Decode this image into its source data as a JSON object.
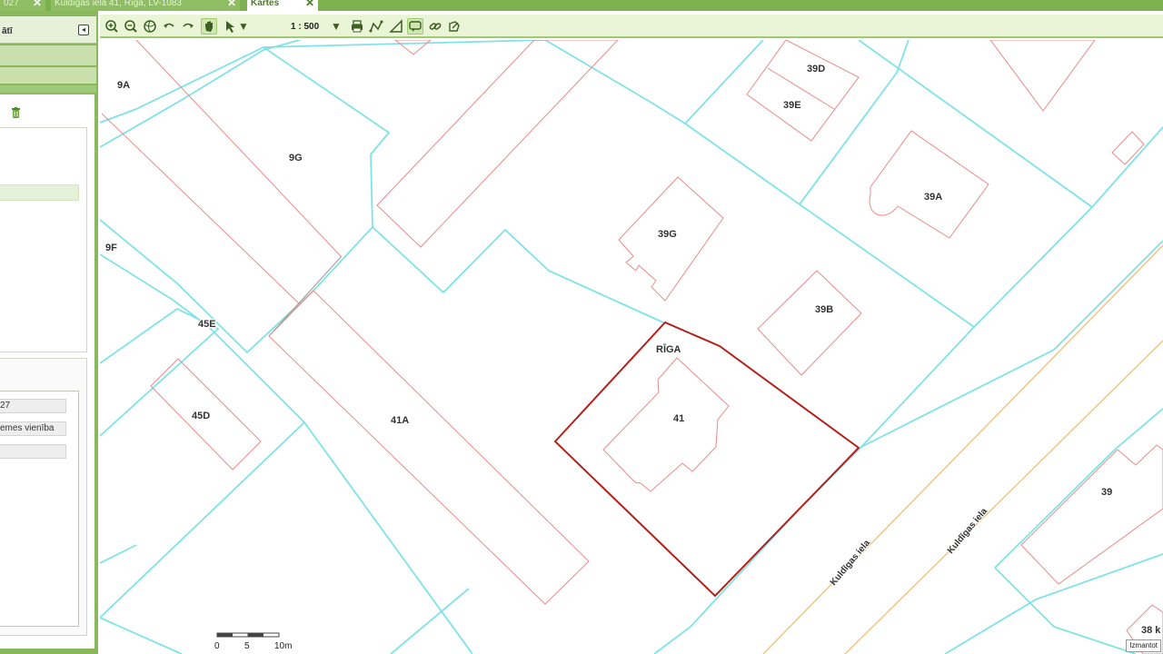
{
  "tabs": [
    {
      "label": "027"
    },
    {
      "label": "Kuldīgas iela 41, Rīga, LV-1083"
    },
    {
      "label": "Kartes"
    }
  ],
  "left_panel": {
    "title": "ātī",
    "fields": [
      "27",
      "emes vienība",
      ""
    ]
  },
  "toolbar": {
    "scale": "1 : 500",
    "tools": [
      "zoom-in",
      "zoom-out",
      "full-extent",
      "undo",
      "redo",
      "pan",
      "select",
      "print",
      "measure-distance",
      "measure-area",
      "callout",
      "link",
      "export"
    ]
  },
  "map": {
    "parcel_labels": [
      "9A",
      "9G",
      "9F",
      "45E",
      "45D",
      "41A",
      "39G",
      "39D",
      "39E",
      "39A",
      "39B",
      "41",
      "39",
      "38 k"
    ],
    "city_label": "RĪGA",
    "street_labels": [
      "Kuldīgas iela",
      "Kuldīgas iela"
    ],
    "scale_bar": {
      "ticks": [
        "0",
        "5",
        "10m"
      ]
    },
    "usage_tag": "Izmantot"
  },
  "colors": {
    "parcel_boundary": "#7fe3e6",
    "building_outline": "#e88b8b",
    "selected_parcel": "#b3211c",
    "street_centerline": "#f2c27a",
    "accent_green": "#7db04f"
  }
}
